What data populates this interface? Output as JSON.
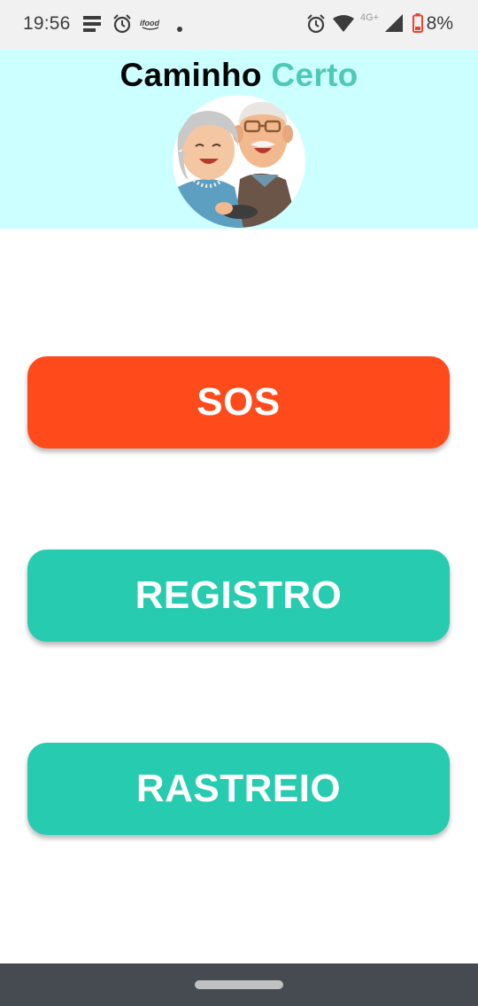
{
  "status_bar": {
    "time": "19:56",
    "network_label": "4G+",
    "battery_percent": "8%",
    "icons": [
      "notes-icon",
      "alarm-icon",
      "ifood-icon",
      "dot-icon",
      "alarm-icon",
      "wifi-icon",
      "signal-icon",
      "battery-low-icon"
    ]
  },
  "header": {
    "title_word1": "Caminho",
    "title_word2": "Certo",
    "colors": {
      "background": "#ccffff",
      "title_dark": "#050505",
      "title_accent": "#4fc9b7"
    }
  },
  "buttons": {
    "sos_label": "SOS",
    "registro_label": "REGISTRO",
    "rastreio_label": "RASTREIO",
    "colors": {
      "sos": "#ff4b1c",
      "primary": "#26cbb0"
    }
  }
}
